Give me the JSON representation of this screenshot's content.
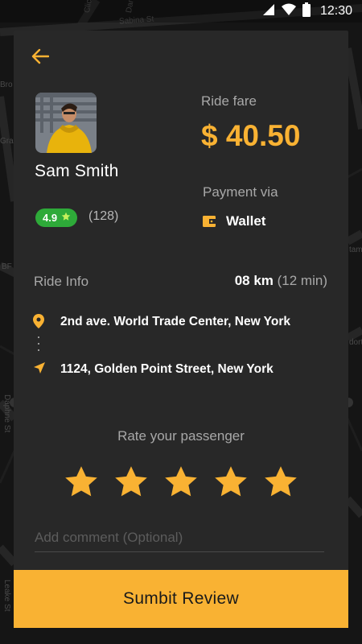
{
  "status_bar": {
    "time": "12:30"
  },
  "map": {
    "streets": [
      "Sabina St",
      "Click Rd",
      "Danile",
      "Daphne St",
      "Leake St",
      "Bro",
      "Gra",
      "BF",
      "tam",
      "dorth"
    ]
  },
  "passenger": {
    "name": "Sam Smith",
    "rating": "4.9",
    "rating_count": "(128)"
  },
  "fare": {
    "label": "Ride fare",
    "value": "$ 40.50"
  },
  "payment": {
    "label": "Payment via",
    "method": "Wallet"
  },
  "ride_info": {
    "label": "Ride Info",
    "distance": "08 km",
    "duration": "(12 min)",
    "pickup": "2nd ave. World Trade Center, New York",
    "dropoff": "1124, Golden Point Street, New York"
  },
  "rating_section": {
    "label": "Rate your passenger",
    "stars": 5,
    "max_stars": 5
  },
  "comment": {
    "placeholder": "Add comment (Optional)",
    "value": ""
  },
  "submit": {
    "label": "Sumbit Review"
  },
  "colors": {
    "accent": "#f9b233",
    "card": "#282828",
    "rating_badge": "#2eaa39"
  },
  "icons": [
    "back-arrow-icon",
    "signal-icon",
    "wifi-icon",
    "battery-icon",
    "star-icon",
    "wallet-icon",
    "location-pin-icon",
    "navigation-arrow-icon"
  ]
}
